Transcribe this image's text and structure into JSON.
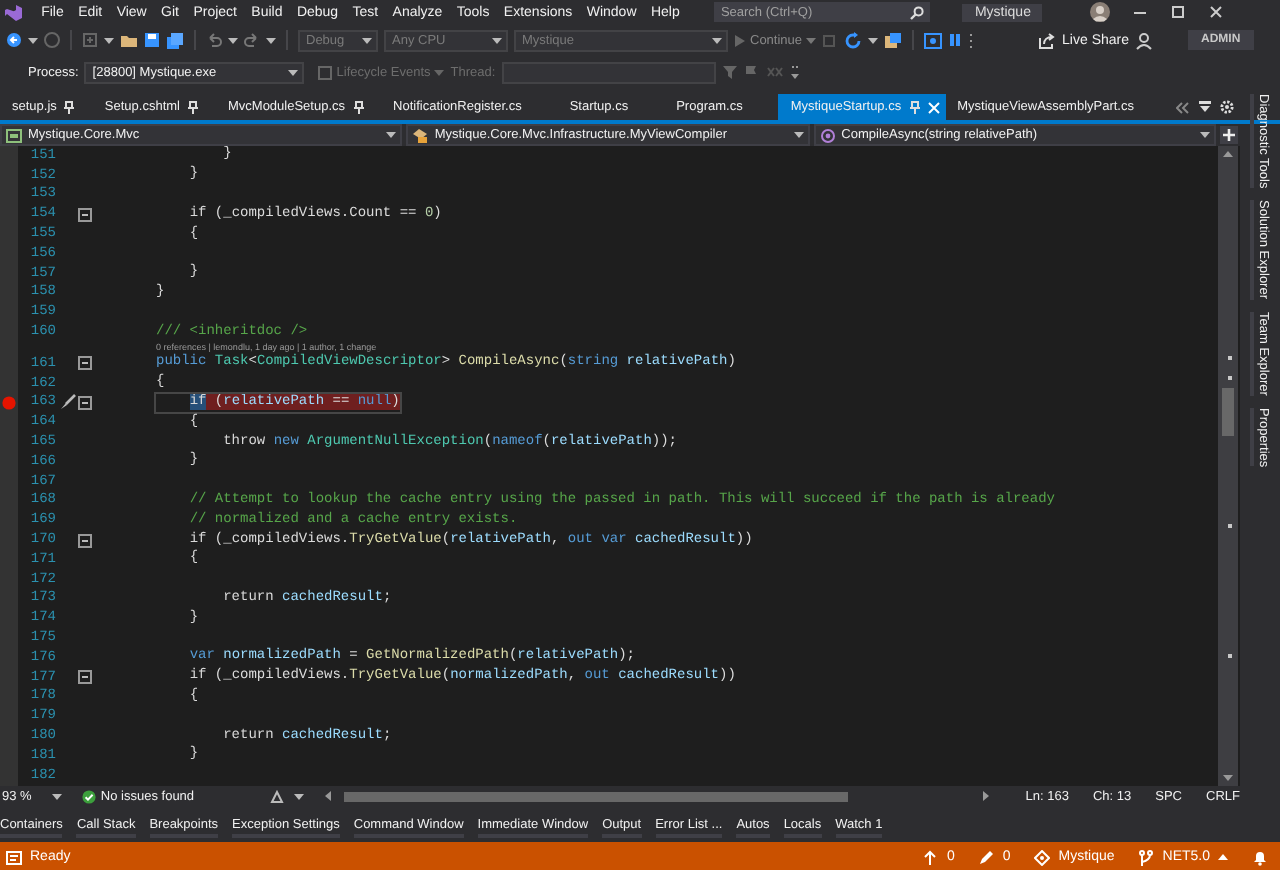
{
  "menu_bar": {
    "items": [
      "File",
      "Edit",
      "View",
      "Git",
      "Project",
      "Build",
      "Debug",
      "Test",
      "Analyze",
      "Tools",
      "Extensions",
      "Window",
      "Help"
    ],
    "search": {
      "placeholder": "Search (Ctrl+Q)"
    },
    "solution_name": "Mystique"
  },
  "toolbar": {
    "configuration": "Debug",
    "platform": "Any CPU",
    "startup_project": "Mystique",
    "continue_label": "Continue",
    "live_share": "Live Share",
    "account_button": "ADMIN"
  },
  "debug_location": {
    "process_label": "Process:",
    "process": "[28800] Mystique.exe",
    "lifecycle_events": "Lifecycle Events",
    "thread_label": "Thread:"
  },
  "tabs": [
    {
      "label": "setup.js",
      "selected": false,
      "pinned": true
    },
    {
      "label": "Setup.cshtml",
      "selected": false,
      "pinned": true
    },
    {
      "label": "MvcModuleSetup.cs",
      "selected": false,
      "pinned": true
    },
    {
      "label": "NotificationRegister.cs",
      "selected": false,
      "pinned": false
    },
    {
      "label": "Startup.cs",
      "selected": false,
      "pinned": false
    },
    {
      "label": "Program.cs",
      "selected": false,
      "pinned": false
    },
    {
      "label": "MystiqueStartup.cs",
      "selected": true,
      "pinned": true
    },
    {
      "label": "MystiqueViewAssemblyPart.cs",
      "selected": false,
      "pinned": false
    }
  ],
  "navigation_bar": {
    "project": "Mystique.Core.Mvc",
    "type": "Mystique.Core.Mvc.Infrastructure.MyViewCompiler",
    "member": "CompileAsync(string relativePath)"
  },
  "code_lines": [
    {
      "number": "151",
      "breakpoint": false,
      "foldable": false,
      "tokens": [
        {
          "kind": "plain",
          "text": "        }"
        }
      ]
    },
    {
      "number": "152",
      "breakpoint": false,
      "foldable": false,
      "tokens": [
        {
          "kind": "plain",
          "text": "    }"
        }
      ]
    },
    {
      "number": "153",
      "breakpoint": false,
      "foldable": false
    },
    {
      "number": "154",
      "breakpoint": false,
      "foldable": true,
      "tokens": [
        {
          "kind": "control",
          "text": "    if"
        },
        {
          "kind": "plain",
          "text": " (_compiledViews.Count == "
        },
        {
          "kind": "number",
          "text": "0"
        },
        {
          "kind": "plain",
          "text": ")"
        }
      ]
    },
    {
      "number": "155",
      "breakpoint": false,
      "foldable": false,
      "tokens": [
        {
          "kind": "plain",
          "text": "    {"
        }
      ]
    },
    {
      "number": "156",
      "breakpoint": false,
      "foldable": false
    },
    {
      "number": "157",
      "breakpoint": false,
      "foldable": false,
      "tokens": [
        {
          "kind": "plain",
          "text": "    }"
        }
      ]
    },
    {
      "number": "158",
      "breakpoint": false,
      "foldable": false,
      "tokens": [
        {
          "kind": "plain",
          "text": "}"
        }
      ]
    },
    {
      "number": "159",
      "breakpoint": false,
      "foldable": false
    },
    {
      "number": "160",
      "breakpoint": false,
      "foldable": false,
      "tokens": [
        {
          "kind": "comment",
          "text": "/// <inheritdoc />"
        }
      ]
    },
    {
      "number": "161",
      "breakpoint": false,
      "foldable": true,
      "codelens": "0 references | lemondlu, 1 day ago | 1 author, 1 change",
      "tokens": [
        {
          "kind": "keyword",
          "text": "public"
        },
        {
          "kind": "type",
          "text": " Task"
        },
        {
          "kind": "plain",
          "text": "<"
        },
        {
          "kind": "type",
          "text": "CompiledViewDescriptor"
        },
        {
          "kind": "plain",
          "text": "> "
        },
        {
          "kind": "method",
          "text": "CompileAsync"
        },
        {
          "kind": "plain",
          "text": "("
        },
        {
          "kind": "keyword",
          "text": "string"
        },
        {
          "kind": "variable",
          "text": " relativePath"
        },
        {
          "kind": "plain",
          "text": ")"
        }
      ]
    },
    {
      "number": "162",
      "breakpoint": false,
      "foldable": false,
      "tokens": [
        {
          "kind": "plain",
          "text": "{"
        }
      ]
    },
    {
      "number": "163",
      "breakpoint": true,
      "foldable": true,
      "tokens": [
        {
          "kind": "selection",
          "text": "    if"
        },
        {
          "kind": "plain",
          "text": " ("
        },
        {
          "kind": "variable",
          "text": "relativePath"
        },
        {
          "kind": "plain",
          "text": " == "
        },
        {
          "kind": "keyword",
          "text": "null"
        },
        {
          "kind": "plain",
          "text": ")"
        }
      ]
    },
    {
      "number": "164",
      "breakpoint": false,
      "foldable": false,
      "tokens": [
        {
          "kind": "plain",
          "text": "    {"
        }
      ]
    },
    {
      "number": "165",
      "breakpoint": false,
      "foldable": false,
      "tokens": [
        {
          "kind": "control",
          "text": "        throw"
        },
        {
          "kind": "keyword",
          "text": " new"
        },
        {
          "kind": "type",
          "text": " ArgumentNullException"
        },
        {
          "kind": "plain",
          "text": "("
        },
        {
          "kind": "keyword",
          "text": "nameof"
        },
        {
          "kind": "plain",
          "text": "("
        },
        {
          "kind": "variable",
          "text": "relativePath"
        },
        {
          "kind": "plain",
          "text": "));"
        }
      ]
    },
    {
      "number": "166",
      "breakpoint": false,
      "foldable": false,
      "tokens": [
        {
          "kind": "plain",
          "text": "    }"
        }
      ]
    },
    {
      "number": "167",
      "breakpoint": false,
      "foldable": false
    },
    {
      "number": "168",
      "breakpoint": false,
      "foldable": false,
      "tokens": [
        {
          "kind": "comment",
          "text": "    // Attempt to lookup the cache entry using the passed in path. This will succeed if the path is already"
        }
      ]
    },
    {
      "number": "169",
      "breakpoint": false,
      "foldable": false,
      "tokens": [
        {
          "kind": "comment",
          "text": "    // normalized and a cache entry exists."
        }
      ]
    },
    {
      "number": "170",
      "breakpoint": false,
      "foldable": true,
      "tokens": [
        {
          "kind": "control",
          "text": "    if"
        },
        {
          "kind": "plain",
          "text": " (_compiledViews."
        },
        {
          "kind": "method",
          "text": "TryGetValue"
        },
        {
          "kind": "plain",
          "text": "("
        },
        {
          "kind": "variable",
          "text": "relativePath"
        },
        {
          "kind": "plain",
          "text": ", "
        },
        {
          "kind": "keyword",
          "text": "out var"
        },
        {
          "kind": "variable",
          "text": " cachedResult"
        },
        {
          "kind": "plain",
          "text": "))"
        }
      ]
    },
    {
      "number": "171",
      "breakpoint": false,
      "foldable": false,
      "tokens": [
        {
          "kind": "plain",
          "text": "    {"
        }
      ]
    },
    {
      "number": "172",
      "breakpoint": false,
      "foldable": false
    },
    {
      "number": "173",
      "breakpoint": false,
      "foldable": false,
      "tokens": [
        {
          "kind": "control",
          "text": "        return"
        },
        {
          "kind": "variable",
          "text": " cachedResult"
        },
        {
          "kind": "plain",
          "text": ";"
        }
      ]
    },
    {
      "number": "174",
      "breakpoint": false,
      "foldable": false,
      "tokens": [
        {
          "kind": "plain",
          "text": "    }"
        }
      ]
    },
    {
      "number": "175",
      "breakpoint": false,
      "foldable": false
    },
    {
      "number": "176",
      "breakpoint": false,
      "foldable": false,
      "tokens": [
        {
          "kind": "keyword",
          "text": "    var"
        },
        {
          "kind": "variable",
          "text": " normalizedPath"
        },
        {
          "kind": "plain",
          "text": " = "
        },
        {
          "kind": "method",
          "text": "GetNormalizedPath"
        },
        {
          "kind": "plain",
          "text": "("
        },
        {
          "kind": "variable",
          "text": "relativePath"
        },
        {
          "kind": "plain",
          "text": ");"
        }
      ]
    },
    {
      "number": "177",
      "breakpoint": false,
      "foldable": true,
      "tokens": [
        {
          "kind": "control",
          "text": "    if"
        },
        {
          "kind": "plain",
          "text": " (_compiledViews."
        },
        {
          "kind": "method",
          "text": "TryGetValue"
        },
        {
          "kind": "plain",
          "text": "("
        },
        {
          "kind": "variable",
          "text": "normalizedPath"
        },
        {
          "kind": "plain",
          "text": ", "
        },
        {
          "kind": "keyword",
          "text": "out"
        },
        {
          "kind": "variable",
          "text": " cachedResult"
        },
        {
          "kind": "plain",
          "text": "))"
        }
      ]
    },
    {
      "number": "178",
      "breakpoint": false,
      "foldable": false,
      "tokens": [
        {
          "kind": "plain",
          "text": "    {"
        }
      ]
    },
    {
      "number": "179",
      "breakpoint": false,
      "foldable": false
    },
    {
      "number": "180",
      "breakpoint": false,
      "foldable": false,
      "tokens": [
        {
          "kind": "control",
          "text": "        return"
        },
        {
          "kind": "variable",
          "text": " cachedResult"
        },
        {
          "kind": "plain",
          "text": ";"
        }
      ]
    },
    {
      "number": "181",
      "breakpoint": false,
      "foldable": false,
      "tokens": [
        {
          "kind": "plain",
          "text": "    }"
        }
      ]
    },
    {
      "number": "182",
      "breakpoint": false,
      "foldable": false
    }
  ],
  "editor_status": {
    "zoom": "93 %",
    "issues": "No issues found",
    "line": "Ln: 163",
    "column": "Ch: 13",
    "whitespace": "SPC",
    "line_ending": "CRLF"
  },
  "tool_windows": [
    "Containers",
    "Call Stack",
    "Breakpoints",
    "Exception Settings",
    "Command Window",
    "Immediate Window",
    "Output",
    "Error List ...",
    "Autos",
    "Locals",
    "Watch 1"
  ],
  "side_panels": [
    "Diagnostic Tools",
    "Solution Explorer",
    "Team Explorer",
    "Properties"
  ],
  "status_bar": {
    "text": "Ready",
    "push_count": "0",
    "changes_count": "0",
    "repository": "Mystique",
    "branch": "NET5.0"
  }
}
